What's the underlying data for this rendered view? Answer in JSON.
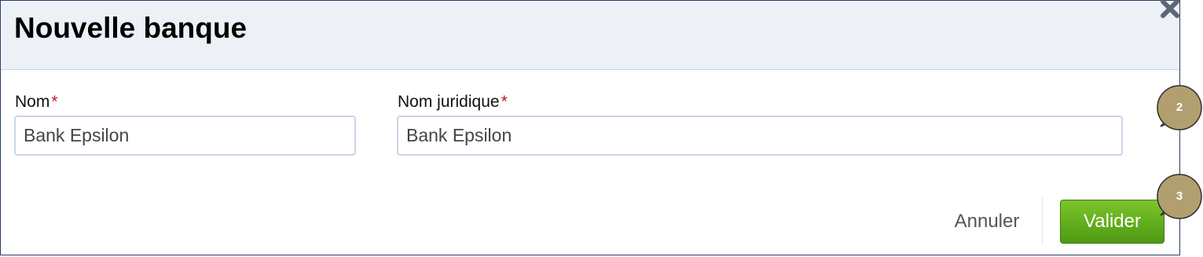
{
  "dialog": {
    "title": "Nouvelle banque",
    "close_icon": "close-icon"
  },
  "form": {
    "nom": {
      "label": "Nom",
      "required_marker": "*",
      "value": "Bank Epsilon"
    },
    "nom_juridique": {
      "label": "Nom juridique",
      "required_marker": "*",
      "value": "Bank Epsilon"
    }
  },
  "footer": {
    "cancel_label": "Annuler",
    "submit_label": "Valider"
  },
  "callouts": [
    {
      "number": "2"
    },
    {
      "number": "3"
    }
  ],
  "colors": {
    "header_bg": "#edf1f7",
    "border": "#2d3e66",
    "required": "#c0162b",
    "submit_green": "#5aa81a",
    "callout_fill": "#b19f6f"
  }
}
